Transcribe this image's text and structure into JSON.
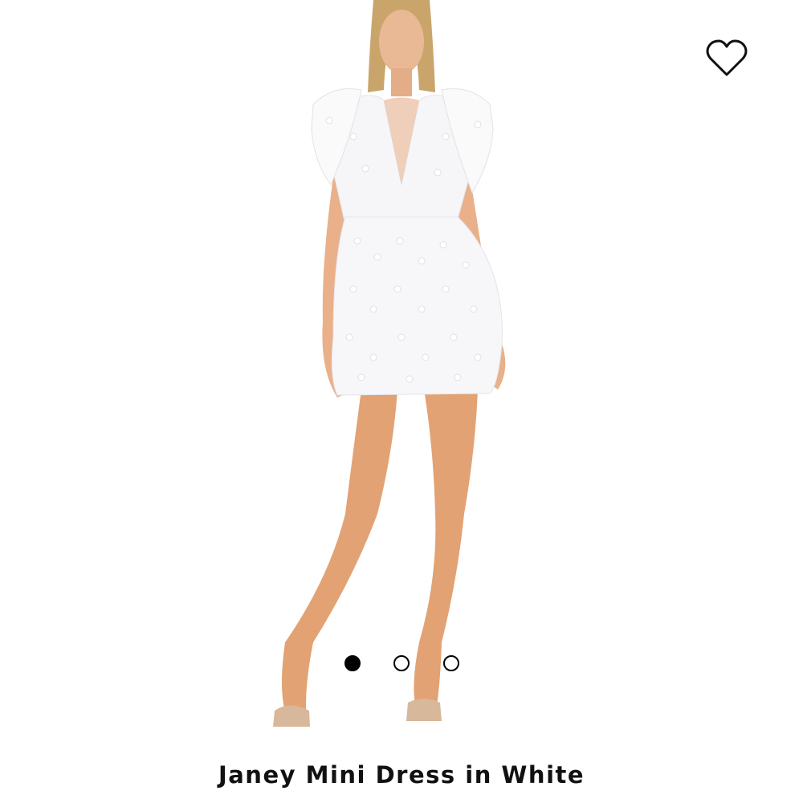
{
  "product": {
    "title": "Janey Mini Dress in White",
    "image_alt": "Model wearing white mini dress"
  },
  "wishlist": {
    "icon": "heart-outline-icon"
  },
  "carousel": {
    "total_slides": 3,
    "active_index": 0
  },
  "colors": {
    "accent": "#000000",
    "background": "#ffffff"
  }
}
